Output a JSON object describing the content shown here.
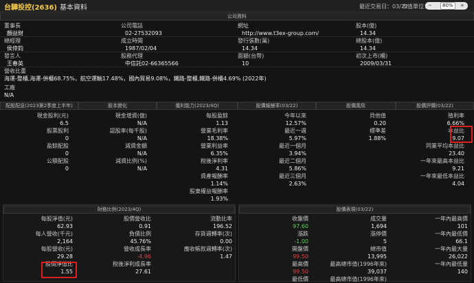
{
  "header": {
    "stock_name": "台驊投控(2636)",
    "page_title": "基本資料",
    "last_trade": "最近交易日：03/22",
    "price_unit": "市值單位：百萬",
    "zoom": {
      "minus": "−",
      "value": "80%",
      "plus": "+"
    }
  },
  "company": {
    "section_title": "公司資料",
    "row1": {
      "l1": "董事長",
      "v1": "顏益財",
      "l2": "公司電話",
      "v2": "02-27532093",
      "l3": "網址",
      "v3": "http://www.t3ex-group.com/",
      "l4": "股本(億)",
      "v4": "14.34"
    },
    "row2": {
      "l1": "總經理",
      "v1": "侯倖鈞",
      "l2": "成立時間",
      "v2": "1987/02/04",
      "l3": "發行張數(萬)",
      "v3": "14.34",
      "l4": "總股本(億)",
      "v4": "14.34"
    },
    "row3": {
      "l1": "發言人",
      "v1": "王春英",
      "l2": "股務代理",
      "v2": "中信託02-66365566",
      "l3": "面額(台幣)",
      "v3": "10",
      "l4": "初次上市(櫃)",
      "v4": "2009/03/31"
    },
    "revenue_label": "營收比重",
    "revenue_text": "海運-整櫃,海運-併櫃68.75%，航空運輸17.48%，國內貿易9.08%，鐵路-整櫃,鐵路-併櫃4.69% (2022年)",
    "factory_label": "工廠",
    "factory_value": "N/A"
  },
  "dividend": {
    "title": "配股配息(2023第2季度上半年)",
    "rows": [
      {
        "label": "現金股利(元)",
        "value": "6.5"
      },
      {
        "label": "股票股利",
        "value": "0"
      },
      {
        "label": "盈餘配股",
        "value": "0"
      },
      {
        "label": "公積配股",
        "value": "0"
      }
    ]
  },
  "capital_change": {
    "title": "股本變化",
    "rows": [
      {
        "label": "現金增資(億)",
        "value": "N/A"
      },
      {
        "label": "認股率(每千股)",
        "value": "N/A"
      },
      {
        "label": "減資金額",
        "value": "N/A"
      },
      {
        "label": "減資比例(%)",
        "value": "N/A"
      }
    ]
  },
  "profitability": {
    "title": "獲利能力(2023/4Q)",
    "rows": [
      {
        "label": "每股盈餘",
        "value": "1.13"
      },
      {
        "label": "營業毛利率",
        "value": "18.38%"
      },
      {
        "label": "營業利益率",
        "value": "6.35%"
      },
      {
        "label": "稅後淨利率",
        "value": "4.31"
      },
      {
        "label": "資產報酬率",
        "value": "1.14%"
      },
      {
        "label": "股東權益報酬率",
        "value": "1.93%"
      }
    ]
  },
  "returns": {
    "title": "股價報酬率(03/22)",
    "rows": [
      {
        "label": "今年以來",
        "value": "12.57%"
      },
      {
        "label": "最近一週",
        "value": "5.97%"
      },
      {
        "label": "最近一個月",
        "value": "3.94%"
      },
      {
        "label": "最近二個月",
        "value": "5.86%"
      },
      {
        "label": "最近三個月",
        "value": "2.63%"
      }
    ]
  },
  "risk": {
    "title": "股價風險",
    "rows": [
      {
        "label": "貝他值",
        "value": "0.20"
      },
      {
        "label": "標準差",
        "value": "1.88%"
      }
    ]
  },
  "valuation": {
    "title": "股價評價(03/22)",
    "rows": [
      {
        "label": "殖利率",
        "value": "6.66%"
      },
      {
        "label": "本益比",
        "value": "9.07"
      },
      {
        "label": "同業平均本益比",
        "value": "23.40"
      },
      {
        "label": "一年來最高本益比",
        "value": "9.21"
      },
      {
        "label": "一年來最低本益比",
        "value": "4.04"
      }
    ]
  },
  "financial": {
    "title": "財務比例(2023/4Q)",
    "rows": [
      {
        "l1": "每股淨值(元)",
        "v1": "62.93",
        "l2": "股價營收比",
        "v2": "0.91",
        "l3": "流動比率",
        "v3": "196.52"
      },
      {
        "l1": "每人營收(千元)",
        "v1": "2,164",
        "l2": "負債比例",
        "v2": "45.76%",
        "l3": "存貨週轉率(次)",
        "v3": "0.00"
      },
      {
        "l1": "每股營收(元)",
        "v1": "29.28",
        "l2": "營收成長率",
        "v2": "-4.96",
        "l3": "應收帳款週轉率(次)",
        "v3": "1.47"
      },
      {
        "l1": "股價淨值比",
        "v1": "1.55",
        "l2": "稅後淨利成長率",
        "v2": "27.61",
        "l3": "",
        "v3": ""
      }
    ]
  },
  "market": {
    "title": "股價表現(03/22)",
    "rows": [
      {
        "l1": "收盤價",
        "v1": "97.60",
        "l2": "成交量",
        "v2": "1,694",
        "l3": "一年內最高價",
        "v3": "101"
      },
      {
        "l1": "漲跌",
        "v1": "-1.00",
        "l2": "漲停價",
        "v2": "5",
        "l3": "一年內最低價",
        "v3": "66.1"
      },
      {
        "l1": "開盤價",
        "v1": "99.50",
        "l2": "總市值",
        "v2": "13,995",
        "l3": "一年內最大量",
        "v3": "26,022"
      },
      {
        "l1": "最高價",
        "v1": "99.50",
        "l2": "最高總市值(1996年來)",
        "v2": "39,037",
        "l3": "一年內最低量",
        "v3": "140"
      },
      {
        "l1": "最低價",
        "v1": "",
        "l2": "最高總市值(1996年來)",
        "v2": "",
        "l3": "",
        "v3": ""
      }
    ]
  }
}
